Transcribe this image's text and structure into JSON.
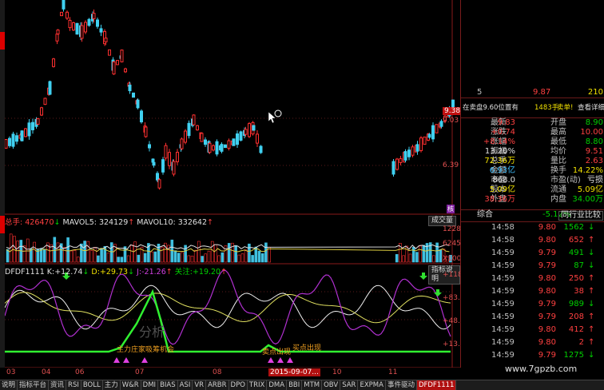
{
  "price_pane": {
    "ylabels": [
      "9.38",
      "9.03",
      "6.39"
    ],
    "tag": "核"
  },
  "volume_pane": {
    "title_label": "总手:",
    "total": "426470",
    "mavol5_label": "MAVOL5:",
    "mavol5": "324129",
    "mavol10_label": "MAVOL10:",
    "mavol10": "332642",
    "button": "成交量",
    "ylabels": [
      "12289",
      "6245",
      "X100"
    ]
  },
  "indicator_pane": {
    "name": "DFDF1111",
    "k_label": "K:",
    "k": "+12.74",
    "d_label": "D:",
    "d": "+29.73",
    "j_label": "J:",
    "j": "-21.26",
    "focus_label": "关注:",
    "focus": "+19.20",
    "button": "指标说明",
    "ylabels": [
      "+118.7",
      "+83.68",
      "+48.71",
      "+13.73"
    ],
    "annotations": [
      "主力庄家吸筹机会",
      "卖点出现",
      "买点出现"
    ],
    "watermark": "分析"
  },
  "xaxis": {
    "labels": [
      "03",
      "04",
      "06",
      "07",
      "08",
      "2015-09-07...",
      "10",
      "11"
    ]
  },
  "quote": {
    "top_rows": [
      {
        "idx": "5",
        "price": "9.87",
        "vol": "210"
      },
      {
        "idx": "",
        "price": "",
        "vol": ""
      }
    ],
    "order_banner": {
      "text": "在卖盘9.60位置有",
      "qty": "1483手",
      "sell": "卖单!",
      "detail": "查看详细"
    },
    "stats": [
      {
        "l1": "最新",
        "v1": "9.83",
        "l2": "开盘",
        "v2": "8.90",
        "c1": "red",
        "c2": "grn"
      },
      {
        "l1": "涨跌",
        "v1": "+0.74",
        "l2": "最高",
        "v2": "10.00",
        "c1": "red",
        "c2": "red"
      },
      {
        "l1": "涨幅",
        "v1": "+8.14%",
        "l2": "最低",
        "v2": "8.80",
        "c1": "red",
        "c2": "grn"
      },
      {
        "l1": "振幅",
        "v1": "13.20%",
        "l2": "均价",
        "v2": "9.51",
        "c1": "white",
        "c2": "red"
      },
      {
        "l1": "总手",
        "v1": "72.36万",
        "l2": "量比",
        "v2": "2.63",
        "c1": "yel",
        "c2": "red"
      },
      {
        "l1": "金额",
        "v1": "6.93亿",
        "l2": "换手",
        "v2": "14.22%",
        "c1": "cyan",
        "c2": "yel"
      },
      {
        "l1": "市盈",
        "v1": "868.0",
        "l2": "市盈(动)",
        "v2": "亏损",
        "c1": "white",
        "c2": "white"
      },
      {
        "l1": "股本",
        "v1": "5.09亿",
        "l2": "流通",
        "v2": "5.09亿",
        "c1": "yel",
        "c2": "yel"
      },
      {
        "l1": "外盘",
        "v1": "38.36万",
        "l2": "内盘",
        "v2": "34.00万",
        "c1": "red",
        "c2": "grn"
      }
    ],
    "summary": {
      "label": "综合",
      "pct": "-5.12%",
      "button": "同行业比较"
    },
    "ticks": [
      {
        "t": "14:58",
        "p": "9.80",
        "v": "1562",
        "d": "dn"
      },
      {
        "t": "14:58",
        "p": "9.80",
        "v": "652",
        "d": "up"
      },
      {
        "t": "14:59",
        "p": "9.79",
        "v": "491",
        "d": "dn"
      },
      {
        "t": "14:59",
        "p": "9.79",
        "v": "87",
        "d": "dn"
      },
      {
        "t": "14:59",
        "p": "9.80",
        "v": "250",
        "d": "up"
      },
      {
        "t": "14:59",
        "p": "9.80",
        "v": "38",
        "d": "up"
      },
      {
        "t": "14:59",
        "p": "9.79",
        "v": "989",
        "d": "dn"
      },
      {
        "t": "14:59",
        "p": "9.79",
        "v": "208",
        "d": "up"
      },
      {
        "t": "14:59",
        "p": "9.80",
        "v": "412",
        "d": "up"
      },
      {
        "t": "14:59",
        "p": "9.80",
        "v": "2",
        "d": "up"
      },
      {
        "t": "14:59",
        "p": "9.79",
        "v": "1275",
        "d": "dn"
      }
    ]
  },
  "tabs": [
    "说明",
    "指标平台",
    "资讯",
    "RSI",
    "BOLL",
    "主力",
    "W&R",
    "DMI",
    "BIAS",
    "ASI",
    "VR",
    "ARBR",
    "DPO",
    "TRIX",
    "DMA",
    "BBI",
    "MTM",
    "OBV",
    "SAR",
    "EXPMA",
    "事件驱动",
    "DFDF1111"
  ],
  "active_tab": 21,
  "site": "www.7gpzb.com"
}
